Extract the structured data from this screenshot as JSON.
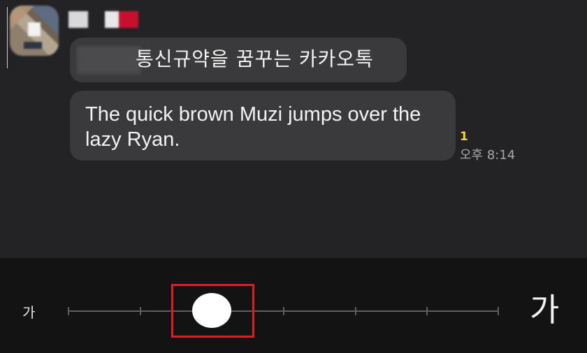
{
  "chat": {
    "messages": [
      {
        "text": "통신규약을 꿈꾸는 카카오톡"
      },
      {
        "text": "The quick brown Muzi jumps over the lazy Ryan."
      }
    ],
    "unread_count": "1",
    "time": "오후 8:14"
  },
  "font_size_slider": {
    "min_label": "가",
    "max_label": "가",
    "value_fraction": 0.333
  },
  "colors": {
    "chat_background": "#232325",
    "bubble": "#3a3a3c",
    "bottom_panel": "#131313",
    "unread": "#f0d33a",
    "highlight": "#e11d2a"
  },
  "icons": {
    "avatar": "profile-avatar"
  }
}
